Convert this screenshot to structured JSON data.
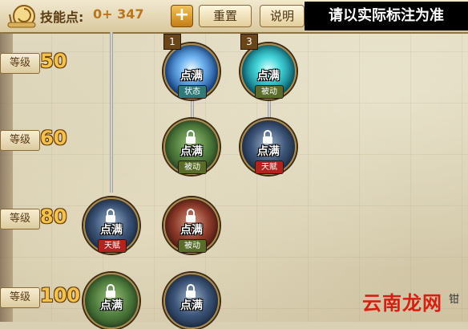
{
  "topbar": {
    "skill_points_label": "技能点:",
    "skill_points_value": "0+ 347",
    "plus_button": "+",
    "reset_button": "重置",
    "info_button": "说明",
    "notice": "请以实际标注为准"
  },
  "levels": [
    {
      "tag": "等级",
      "value": "50"
    },
    {
      "tag": "等级",
      "value": "60"
    },
    {
      "tag": "等级",
      "value": "80"
    },
    {
      "tag": "等级",
      "value": "100"
    }
  ],
  "skills": [
    {
      "state": "点满",
      "tag": "状态",
      "badge": "1",
      "color": "blue"
    },
    {
      "state": "点满",
      "tag": "被动",
      "badge": "3",
      "color": "teal"
    },
    {
      "state": "点满",
      "tag": "被动",
      "color": "green"
    },
    {
      "state": "点满",
      "tag": "天赋",
      "color": "navy"
    },
    {
      "state": "点满",
      "tag": "天赋",
      "color": "navy"
    },
    {
      "state": "点满",
      "tag": "被动",
      "color": "red"
    },
    {
      "state": "点满",
      "color": "green"
    },
    {
      "state": "点满",
      "color": "navy"
    }
  ],
  "watermark": {
    "text": "云南龙网",
    "small": "钳"
  },
  "colors": {
    "accent": "#f2c24b",
    "talent": "#b0231f",
    "passive": "#5b6b2a",
    "state": "#2f7a78"
  }
}
